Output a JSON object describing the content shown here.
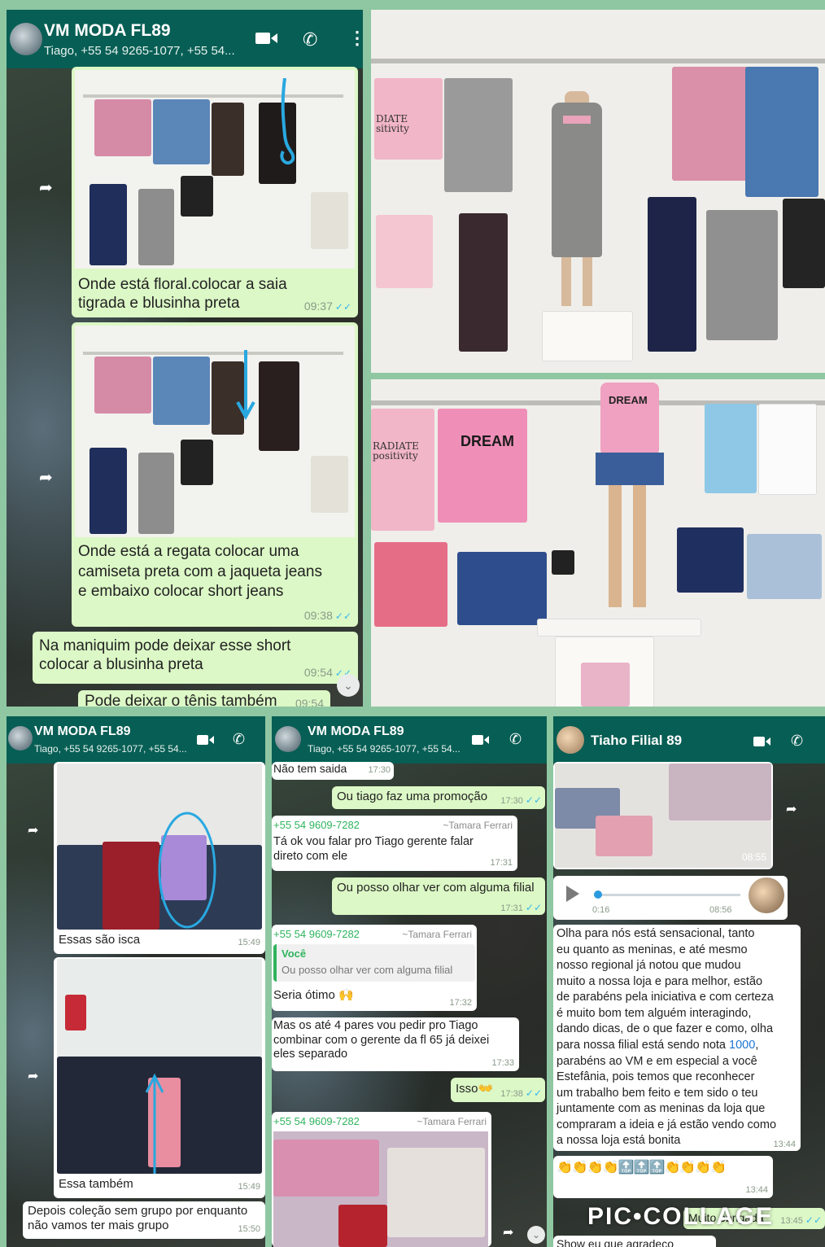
{
  "chat1": {
    "title": "VM MODA FL89",
    "subtitle": "Tiago, +55 54 9265-1077, +55 54...",
    "messages": [
      {
        "text": "Onde está floral.colocar a saia\ntigrada e  blusinha preta",
        "time": "09:37"
      },
      {
        "text": "Onde está a regata colocar uma\ncamiseta  preta com a jaqueta jeans\ne embaixo  colocar  short  jeans",
        "time": "09:38"
      },
      {
        "text": "Na maniquim pode deixar  esse short\ncolocar a blusinha preta",
        "time": "09:54"
      },
      {
        "text": "Pode deixar o tênis também",
        "time": "09:54"
      }
    ]
  },
  "store_photo_top": {
    "shirt_text": "DIATE\nsitivity"
  },
  "store_photo_bottom": {
    "shirt_text_1": "RADIATE\npositivity",
    "shirt_text_2": "DREAM",
    "shirt_text_3": "DREAM"
  },
  "chat2": {
    "title": "VM MODA FL89",
    "subtitle": "Tiago, +55 54 9265-1077, +55 54...",
    "messages": [
      {
        "text": "Essas são  isca",
        "time": "15:49"
      },
      {
        "text": "Essa também",
        "time": "15:49"
      },
      {
        "text": "Depois coleção  sem grupo por enquanto\nnão  vamos ter mais grupo",
        "time": "15:50"
      }
    ]
  },
  "chat3": {
    "title": "VM MODA FL89",
    "subtitle": "Tiago, +55 54 9265-1077, +55 54...",
    "messages": [
      {
        "text": "Não tem saida",
        "time": "17:30"
      },
      {
        "text": "Ou tiago  faz uma promoção",
        "time": "17:30"
      },
      {
        "phone": "+55 54 9609-7282",
        "sender": "~Tamara Ferrari",
        "text": "Tá ok vou falar pro Tiago gerente falar\ndireto com ele",
        "time": "17:31"
      },
      {
        "text": "Ou posso olhar ver com alguma filial",
        "time": "17:31"
      },
      {
        "phone": "+55 54 9609-7282",
        "sender": "~Tamara Ferrari",
        "quote_author": "Você",
        "quote_text": "Ou posso olhar ver com alguma filial",
        "text": "Seria ótimo 🙌",
        "time": "17:32"
      },
      {
        "text": "Mas os até 4 pares vou pedir pro Tiago\ncombinar com o gerente da fl 65 já deixei\neles separado",
        "time": "17:33"
      },
      {
        "text": "Isso👐",
        "time": "17:38"
      },
      {
        "phone": "+55 54 9609-7282",
        "sender": "~Tamara Ferrari"
      }
    ]
  },
  "chat4": {
    "title": "Tiaho Filial 89",
    "video_time": "08:55",
    "audio_elapsed": "0:16",
    "audio_time": "08:56",
    "message_text": "Olha para nós está sensacional, tanto\neu quanto as meninas, e até mesmo\nnosso regional já notou que mudou\nmuito a nossa loja e para melhor, estão\nde parabéns pela iniciativa e com certeza\né muito bom tem alguém interagindo,\ndando dicas, de o que fazer e como, olha\npara nossa filial está sendo nota ",
    "message_highlight": "1000",
    "message_text_after": ",\nparabéns ao VM e em especial a você\nEstefânia, pois temos que reconhecer\num trabalho bem feito e tem sido o teu\njuntamente com as meninas da loja que\ncompraram a ideia e já estão vendo como\na nossa loja está bonita",
    "message_time": "13:44",
    "emoji_text": "👏👏👏👏🔝🔝🔝👏👏👏👏",
    "emoji_time": "13:44",
    "reply_text": "Muito obrigada",
    "reply_time": "13:45",
    "bottom_text": "Show eu que agradeço"
  },
  "watermark": "PIC•COLLAGE"
}
